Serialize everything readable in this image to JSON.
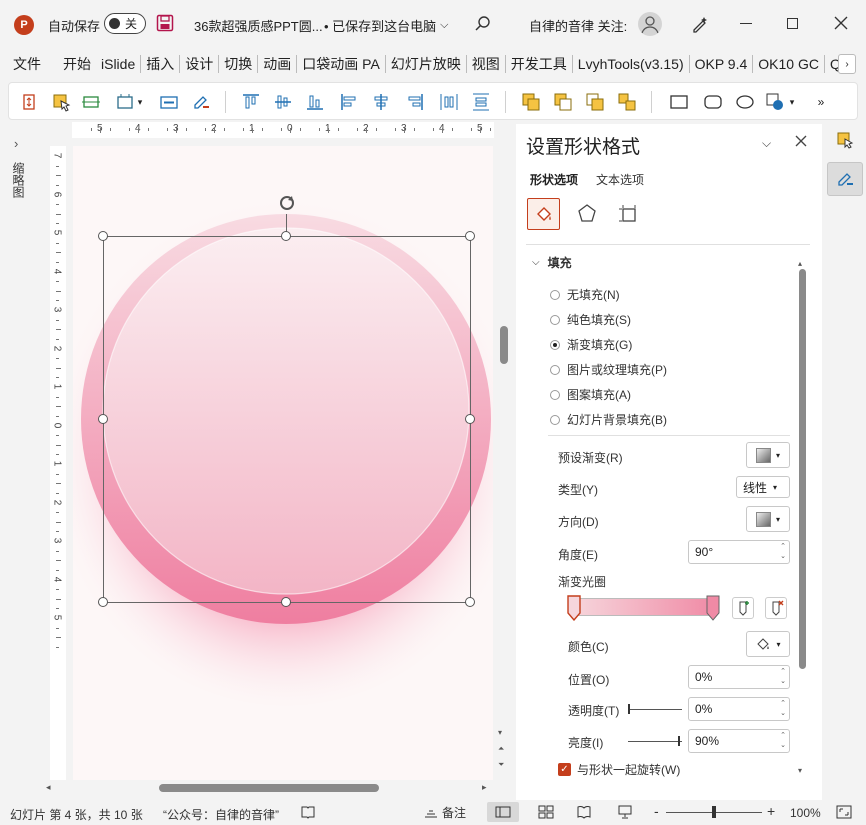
{
  "titlebar": {
    "autosave_label": "自动保存",
    "autosave_toggle": "关",
    "filename": "36款超强质感PPT圆...",
    "save_status": "• 已保存到这台电脑",
    "account": "自律的音律 关注:"
  },
  "ribbon_tabs": [
    "文件",
    "开始",
    "iSlide",
    "插入",
    "设计",
    "切换",
    "动画",
    "口袋动画 PA",
    "幻灯片放映",
    "视图",
    "开发工具",
    "LvyhTools(v3.15)",
    "OKP 9.4",
    "OK10 GC",
    "Qir"
  ],
  "ruler": {
    "h_marks": [
      "5",
      "4",
      "3",
      "2",
      "1",
      "0",
      "1",
      "2",
      "3",
      "4",
      "5"
    ],
    "v_marks": [
      "7",
      "6",
      "5",
      "4",
      "3",
      "2",
      "1",
      "0",
      "1",
      "2",
      "3",
      "4",
      "5"
    ]
  },
  "left_strip": {
    "thumbnail_label": "缩略图"
  },
  "panel": {
    "title": "设置形状格式",
    "tab_shape": "形状选项",
    "tab_text": "文本选项",
    "section_fill": "填充",
    "fill_options": [
      {
        "label": "无填充(N)",
        "selected": false
      },
      {
        "label": "纯色填充(S)",
        "selected": false
      },
      {
        "label": "渐变填充(G)",
        "selected": true
      },
      {
        "label": "图片或纹理填充(P)",
        "selected": false
      },
      {
        "label": "图案填充(A)",
        "selected": false
      },
      {
        "label": "幻灯片背景填充(B)",
        "selected": false
      }
    ],
    "preset_gradient_label": "预设渐变(R)",
    "type_label": "类型(Y)",
    "type_value": "线性",
    "direction_label": "方向(D)",
    "angle_label": "角度(E)",
    "angle_value": "90°",
    "gradient_stops_label": "渐变光圈",
    "color_label": "颜色(C)",
    "position_label": "位置(O)",
    "position_value": "0%",
    "transparency_label": "透明度(T)",
    "transparency_value": "0%",
    "brightness_label": "亮度(I)",
    "brightness_value": "90%",
    "rotate_with_shape_label": "与形状一起旋转(W)",
    "rotate_with_shape_checked": true
  },
  "statusbar": {
    "slide_info": "幻灯片 第 4 张，共 10 张",
    "author_note": "“公众号：自律的音律”",
    "notes_label": "备注",
    "zoom_value": "100%",
    "zoom_minus": "-",
    "zoom_plus": "+"
  },
  "colors": {
    "accent": "#c43e1c",
    "gradient_start": "#f6d6dc",
    "gradient_end": "#f08aa5",
    "ring_outer": "#ef7ea0"
  }
}
